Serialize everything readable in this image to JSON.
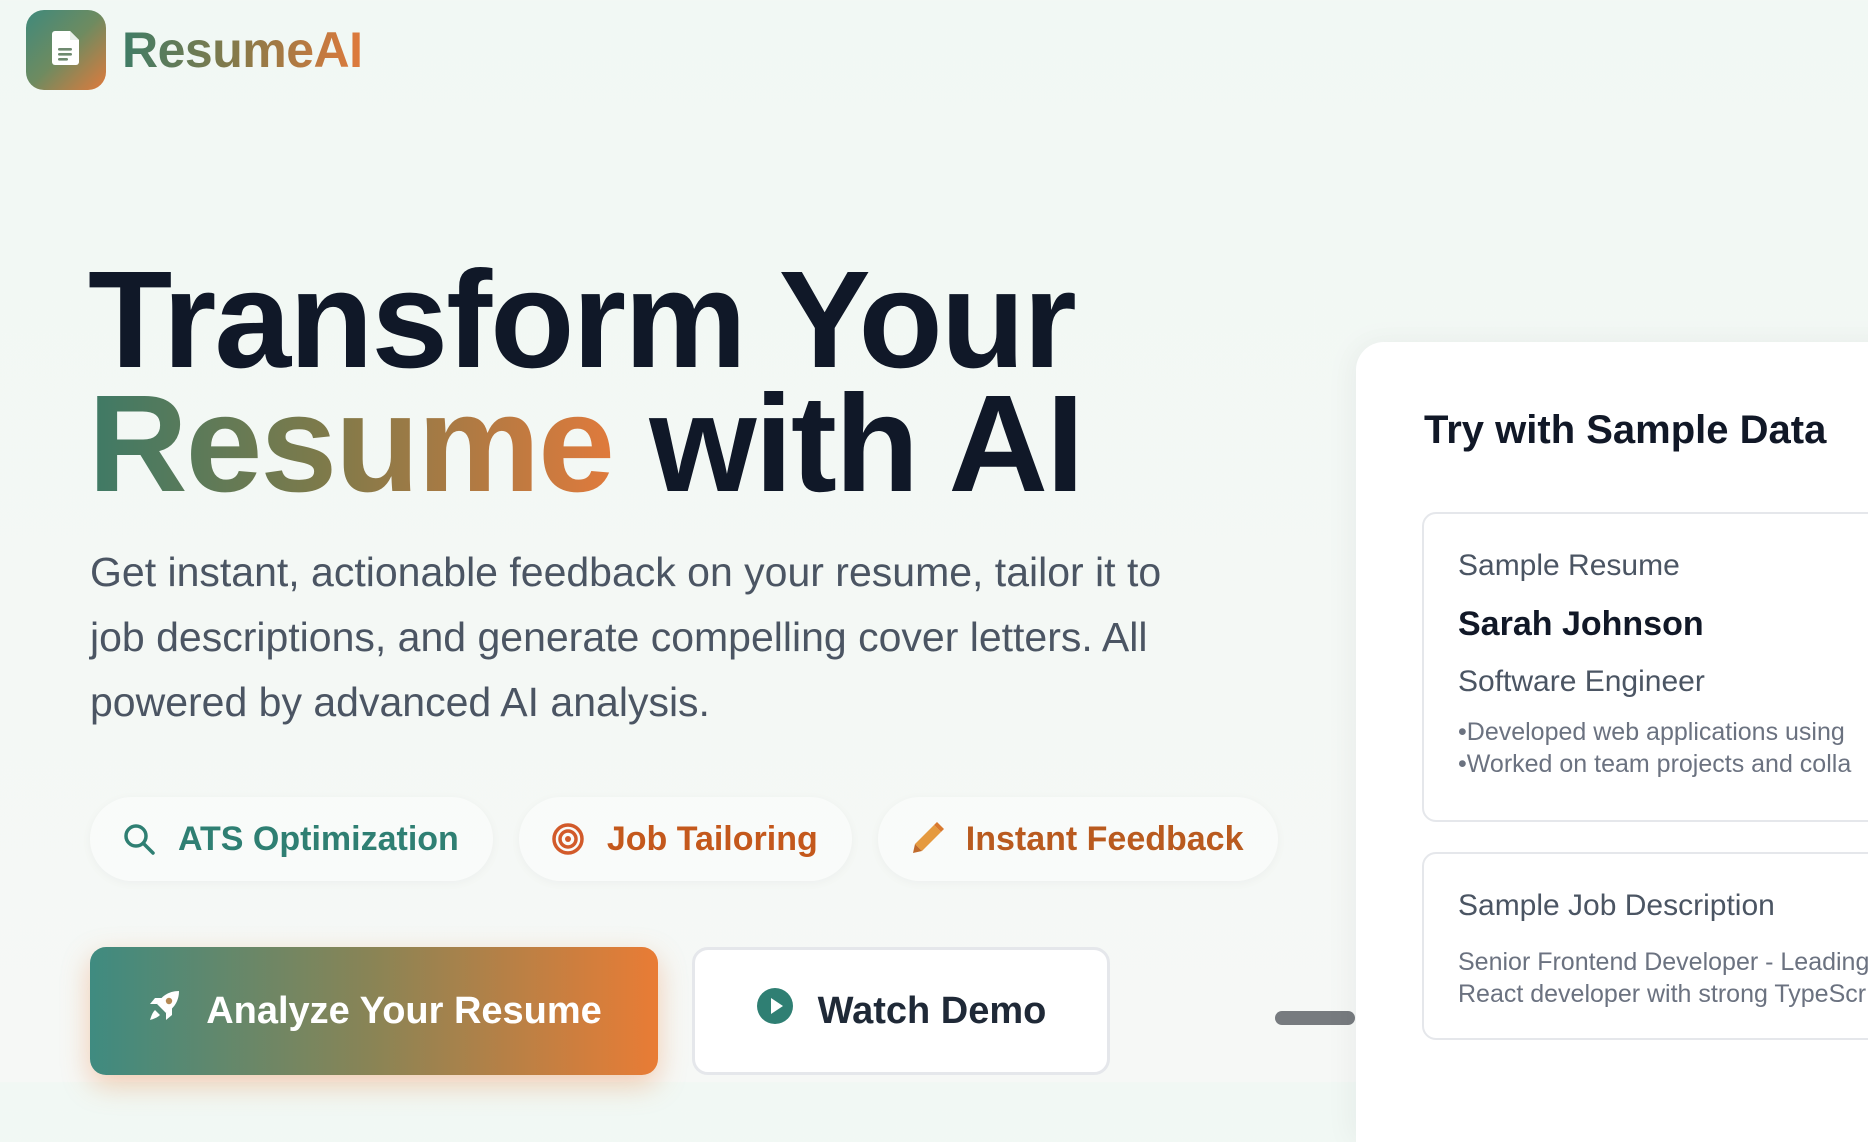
{
  "brand": {
    "name": "ResumeAI",
    "icon": "document-icon"
  },
  "hero": {
    "title_line1": "Transform Your",
    "title_accent": "Resume",
    "title_rest": " with AI",
    "description": "Get instant, actionable feedback on your resume, tailor it to job descriptions, and generate compelling cover letters. All powered by advanced AI analysis."
  },
  "features": [
    {
      "label": "ATS Optimization",
      "icon": "search-icon",
      "color": "#2f7f73"
    },
    {
      "label": "Job Tailoring",
      "icon": "target-icon",
      "color": "#c4581c"
    },
    {
      "label": "Instant Feedback",
      "icon": "pencil-icon",
      "color": "#b95a1f"
    }
  ],
  "cta": {
    "primary_label": "Analyze Your Resume",
    "primary_icon": "rocket-icon",
    "secondary_label": "Watch Demo",
    "secondary_icon": "play-icon"
  },
  "sample": {
    "title": "Try with Sample Data",
    "resume": {
      "label": "Sample Resume",
      "name": "Sarah Johnson",
      "role": "Software Engineer",
      "bullets": [
        "Developed web applications using",
        "Worked on team projects and colla"
      ]
    },
    "job": {
      "label": "Sample Job Description",
      "lines": [
        "Senior Frontend Developer - Leading",
        "React developer with strong TypeScr"
      ]
    }
  },
  "colors": {
    "accent_teal": "#3f8b80",
    "accent_orange": "#e97c35",
    "heading": "#101828",
    "body_text": "#4b5563"
  }
}
